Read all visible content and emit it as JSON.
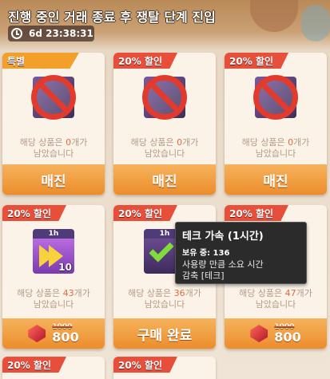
{
  "header": {
    "title": "진행 중인 거래 종료 후 쟁탈 단계 진입",
    "timer": "6d 23:38:31"
  },
  "colors": {
    "special_badge": "#f2a02a",
    "discount_badge": "#e84f3a",
    "button": "#ec8d2c",
    "stock_number": "#e8683a"
  },
  "cards": [
    {
      "badge": "특별",
      "badge_type": "special",
      "stock_prefix": "해당 상품은 ",
      "stock_num": "0",
      "stock_suffix": "개가",
      "stock_line2": "남았습니다",
      "button": "매진",
      "icon": "no-sign-icon"
    },
    {
      "badge": "20% 할인",
      "badge_type": "discount",
      "stock_prefix": "해당 상품은 ",
      "stock_num": "0",
      "stock_suffix": "개가",
      "stock_line2": "남았습니다",
      "button": "매진",
      "icon": "no-sign-icon"
    },
    {
      "badge": "20% 할인",
      "badge_type": "discount",
      "stock_prefix": "해당 상품은 ",
      "stock_num": "0",
      "stock_suffix": "개가",
      "stock_line2": "남았습니다",
      "button": "매진",
      "icon": "no-sign-icon"
    },
    {
      "badge": "20% 할인",
      "badge_type": "discount",
      "hour_tag": "1h",
      "qty": "10",
      "stock_prefix": "해당 상품은 ",
      "stock_num": "43",
      "stock_suffix": "개가",
      "stock_line2": "남았습니다",
      "old_price": "1000",
      "price": "800",
      "icon": "speed-up-icon"
    },
    {
      "badge": "20% 할인",
      "badge_type": "discount",
      "hour_tag": "1h",
      "stock_prefix": "해당 상품은 ",
      "stock_num": "36",
      "stock_suffix": "개가",
      "stock_line2": "남았습니다",
      "button": "구매 완료",
      "icon": "checkmark-icon"
    },
    {
      "badge": "20% 할인",
      "badge_type": "discount",
      "stock_prefix": "해당 상품은 ",
      "stock_num": "47",
      "stock_suffix": "개가",
      "stock_line2": "남았습니다",
      "old_price": "1000",
      "price": "800",
      "icon": "speed-up-icon"
    },
    {
      "badge": "20% 할인",
      "badge_type": "discount"
    },
    {
      "badge": "20% 할인",
      "badge_type": "discount"
    }
  ],
  "tooltip": {
    "title": "테크 가속 (1시간)",
    "owned": "보유 중: 136",
    "line1": "사용량 만큼 소요 시간",
    "line2": "감축 [테크]"
  }
}
